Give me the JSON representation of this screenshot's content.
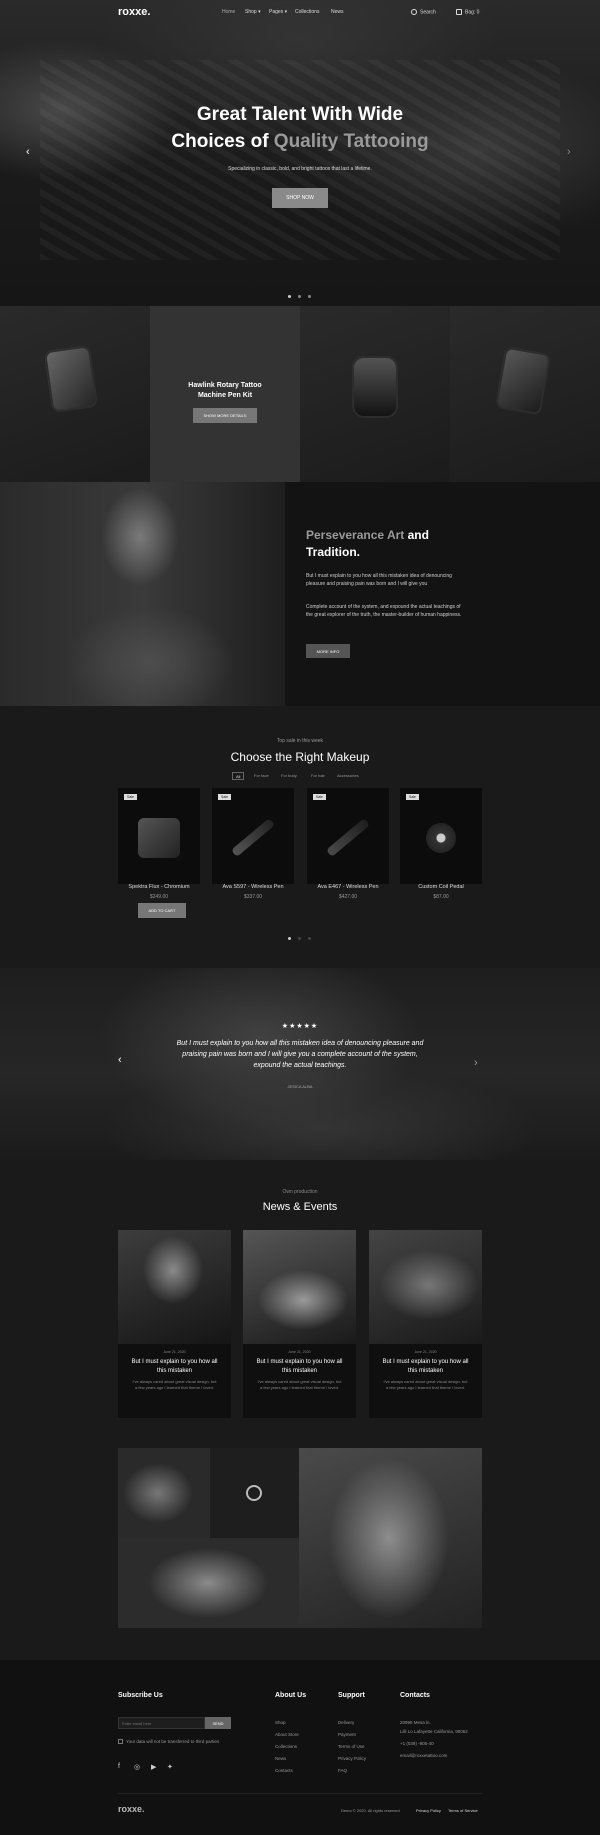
{
  "header": {
    "logo": "roxxe.",
    "nav": [
      {
        "label": "Home"
      },
      {
        "label": "Shop ▾"
      },
      {
        "label": "Pages ▾"
      },
      {
        "label": "Collections"
      },
      {
        "label": "News"
      }
    ],
    "search_label": "Search",
    "bag_label": "Bag: 0"
  },
  "hero": {
    "title_line1": "Great Talent With Wide",
    "title_line2_pre": "Choices of ",
    "title_line2_highlight": "Quality Tattooing",
    "subtitle": "Specializing in classic, bold, and bright tattoos that last a lifetime.",
    "cta": "SHOP NOW",
    "prev_arrow": "‹",
    "next_arrow": "›"
  },
  "featured": {
    "title_line1": "Hawlink Rotary Tattoo",
    "title_line2": "Machine Pen Kit",
    "button": "SHOW MORE DETAILS"
  },
  "perseverance": {
    "title_highlight": "Perseverance Art",
    "title_rest1": " and",
    "title_rest2": "Tradition.",
    "para1": "But I must explain to you how all this mistaken idea of denouncing pleasure and praising pain was born and I will give you",
    "para2": "Complete account of the system, and expound the actual teachings of the great explorer of the truth, the master-builder of human happiness.",
    "button": "MORE INFO"
  },
  "makeup": {
    "kicker": "Top sale in this week",
    "title": "Choose the Right Makeup",
    "tabs": [
      "All",
      "For face",
      "For body",
      "For hair",
      "Accessories"
    ],
    "products": [
      {
        "badge": "Sale",
        "name": "Spektra Flux - Chromium",
        "price": "$249.00"
      },
      {
        "badge": "Sale",
        "name": "Ava S597 - Wireless  Pen",
        "price": "$337.00"
      },
      {
        "badge": "Sale",
        "name": "Ava E467 - Wireless  Pen",
        "price": "$427.00"
      },
      {
        "badge": "Sale",
        "name": "Custom Coil  Pedal",
        "price": "$87.00"
      }
    ],
    "add_to_cart": "ADD TO CART"
  },
  "testimonial": {
    "stars": "★★★★★",
    "quote": "But I must explain to you how all this mistaken idea of denouncing pleasure and praising pain was born and I will give you a complete account of the system, expound the actual teachings.",
    "author": "JESICA ALBA",
    "prev_arrow": "‹",
    "next_arrow": "›"
  },
  "news": {
    "kicker": "Own production",
    "title": "News & Events",
    "items": [
      {
        "date": "June 21, 2020",
        "title": "But I must explain to you how all this mistaken",
        "excerpt": "I’ve always cared about great visual design, but a few years ago I learned that theme I loved."
      },
      {
        "date": "June 21, 2020",
        "title": "But I must explain to you how all this mistaken",
        "excerpt": "I’ve always cared about great visual design, but a few years ago I learned that theme I loved."
      },
      {
        "date": "June 21, 2020",
        "title": "But I must explain to you how all this mistaken",
        "excerpt": "I’ve always cared about great visual design, but a few years ago I learned that theme I loved."
      }
    ]
  },
  "footer": {
    "subscribe_title": "Subscribe Us",
    "email_placeholder": "Enter email here",
    "send": "SEND",
    "consent": "Your data will not be transferred to third parties",
    "about_title": "About Us",
    "about_links": [
      "Shop",
      "About Store",
      "Collections",
      "News",
      "Contacts"
    ],
    "support_title": "Support",
    "support_links": [
      "Delivery",
      "Payment",
      "Terms of Use",
      "Privacy Policy",
      "FAQ"
    ],
    "contacts_title": "Contacts",
    "contacts_lines": [
      "20996 Mesa ln.",
      "Lilli Lo Lafayette California, 90062",
      "+1 (039) -905-40",
      "email@roxxetattoo.com"
    ],
    "logo": "roxxe.",
    "copyright": "Demo © 2020. All rights reserved",
    "privacy": "Privacy Policy",
    "terms": "Terms of Service"
  }
}
